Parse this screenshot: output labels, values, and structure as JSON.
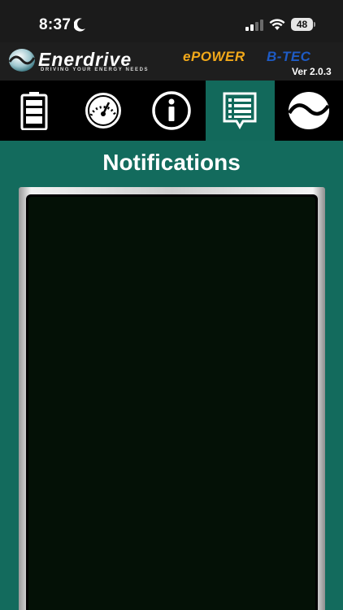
{
  "status_bar": {
    "time": "8:37",
    "battery_level": "48"
  },
  "header": {
    "brand_name": "Enerdrive",
    "brand_tagline": "DRIVING YOUR ENERGY NEEDS",
    "product_name_1": "ePOWER",
    "product_name_2": "B-TEC",
    "version": "Ver 2.0.3"
  },
  "tabs": [
    {
      "icon": "battery-icon",
      "active": false
    },
    {
      "icon": "gauge-icon",
      "active": false
    },
    {
      "icon": "info-icon",
      "active": false
    },
    {
      "icon": "notifications-list-icon",
      "active": true
    },
    {
      "icon": "enerdrive-wave-icon",
      "active": false
    }
  ],
  "main": {
    "title": "Notifications"
  },
  "colors": {
    "accent": "#136b5d",
    "header_bg": "#1e1e1e",
    "epower_orange": "#f2a91a",
    "btec_blue": "#1e5bc4",
    "panel_bg": "#041106"
  }
}
